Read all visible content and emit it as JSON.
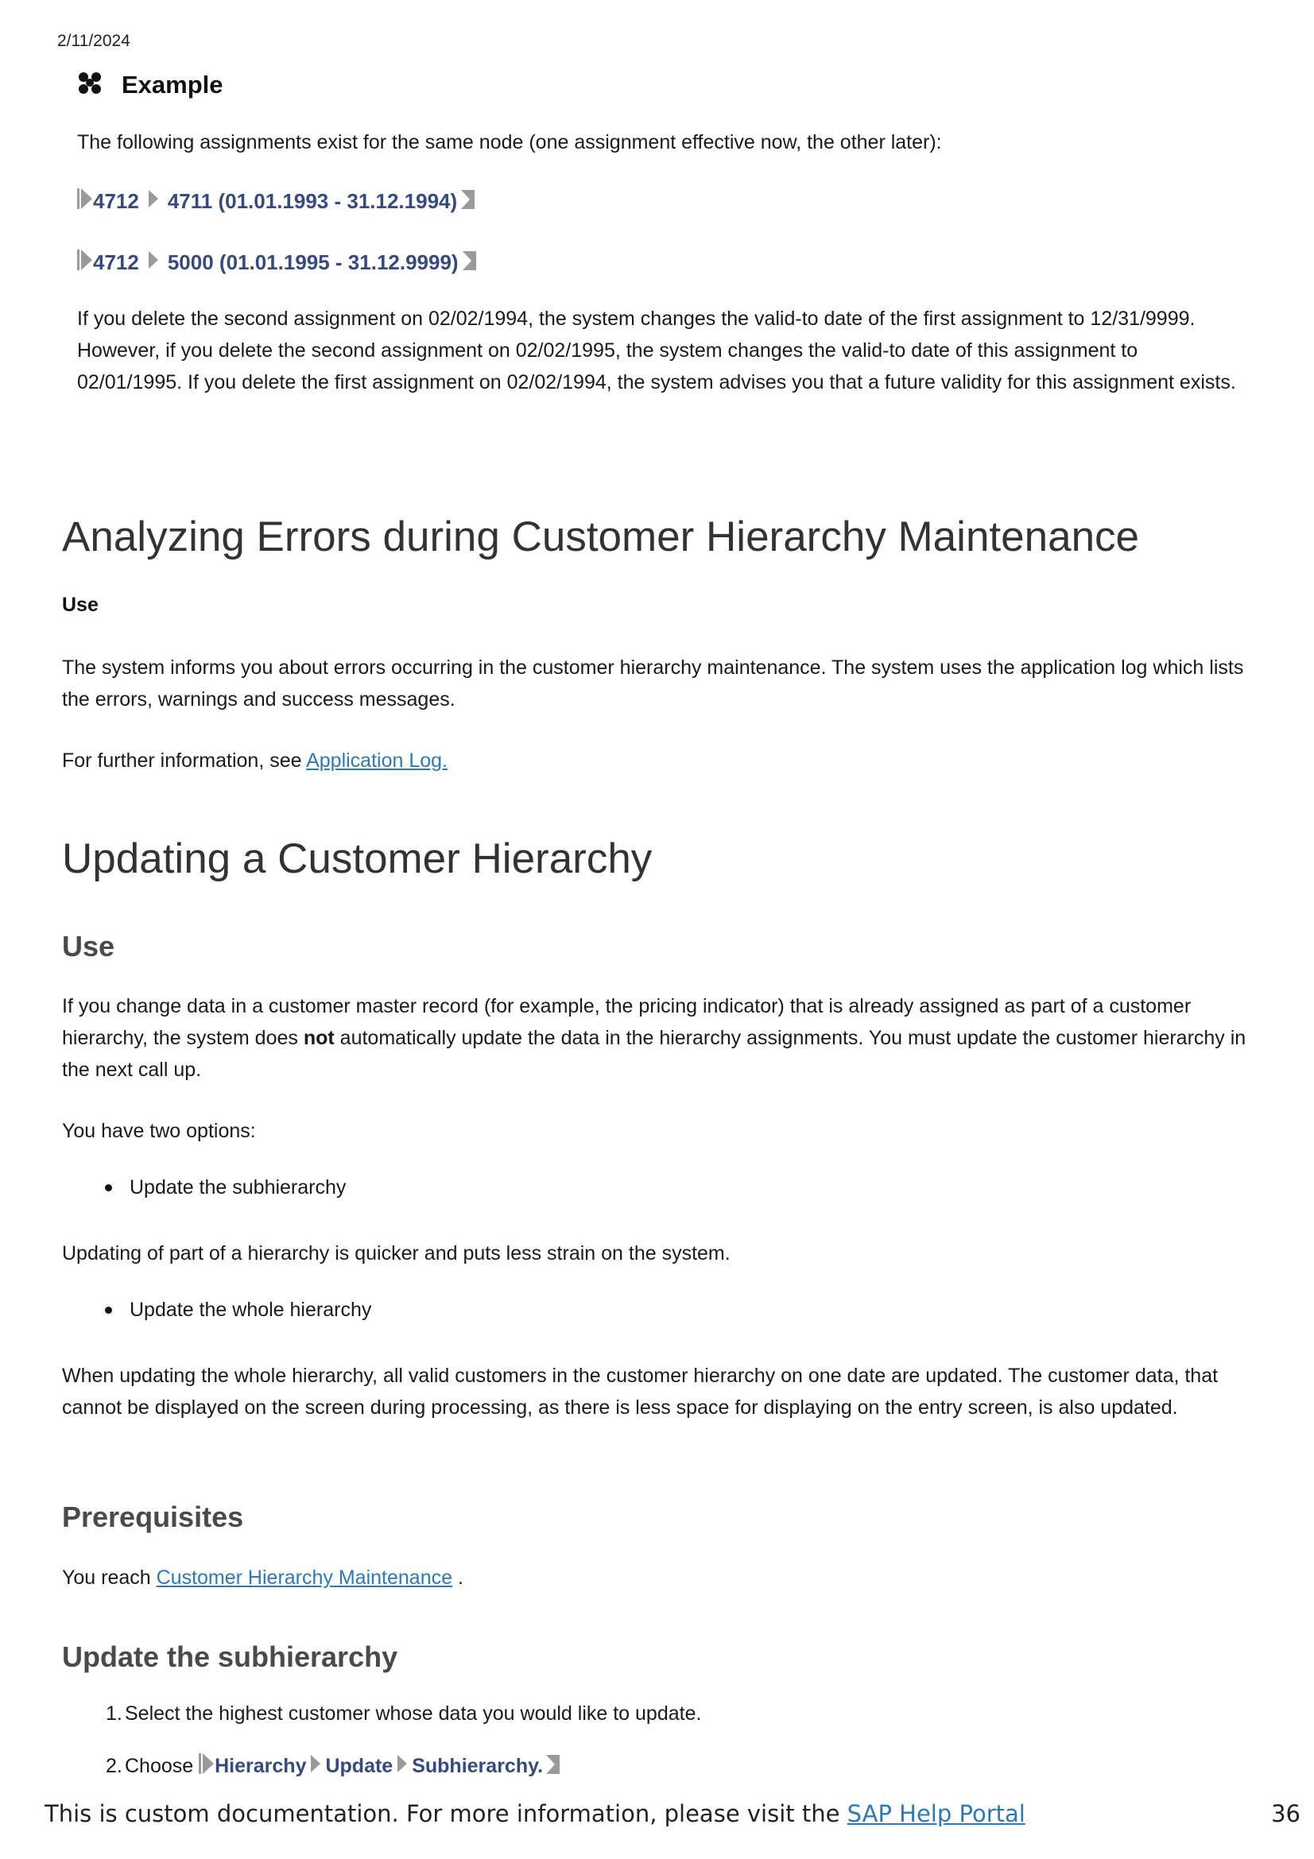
{
  "header": {
    "date": "2/11/2024"
  },
  "example": {
    "title": "Example",
    "intro": "The following assignments exist for the same node (one assignment effective now, the other later):",
    "paths": [
      {
        "node": "4712",
        "assignment": "4711 (01.01.1993 - 31.12.1994)"
      },
      {
        "node": "4712",
        "assignment": "5000 (01.01.1995 - 31.12.9999)"
      }
    ],
    "explanation": "If you delete the second assignment on 02/02/1994, the system changes the valid-to date of the first assignment to 12/31/9999. However, if you delete the second assignment on 02/02/1995, the system changes the valid-to date of this assignment to 02/01/1995. If you delete the first assignment on 02/02/1994, the system advises you that a future validity for this assignment exists."
  },
  "section_errors": {
    "title": "Analyzing Errors during Customer Hierarchy Maintenance",
    "use_label": "Use",
    "body": "The system informs you about errors occurring in the customer hierarchy maintenance. The system uses the application log which lists the errors, warnings and success messages.",
    "further_prefix": "For further information, see ",
    "further_link": "Application Log."
  },
  "section_update": {
    "title": "Updating a Customer Hierarchy",
    "use_heading": "Use",
    "use_body_before": "If you change data in a customer master record (for example, the pricing indicator) that is already assigned as part of a customer hierarchy, the system does ",
    "use_body_bold": "not",
    "use_body_after": " automatically update the data in the hierarchy assignments. You must update the customer hierarchy in the next call up.",
    "options_intro": "You have two options:",
    "option1": "Update the subhierarchy",
    "option1_desc": "Updating of part of a hierarchy is quicker and puts less strain on the system.",
    "option2": "Update the whole hierarchy",
    "option2_desc": "When updating the whole hierarchy, all valid customers in the customer hierarchy on one date are updated. The customer data, that cannot be displayed on the screen during processing, as there is less space for displaying on the entry screen, is also updated.",
    "prereq_heading": "Prerequisites",
    "prereq_prefix": "You reach ",
    "prereq_link": "Customer Hierarchy Maintenance",
    "prereq_suffix": " .",
    "sub_heading": "Update the subhierarchy",
    "step1": "Select the highest customer whose data you would like to update.",
    "step2_prefix": "Choose ",
    "step2_path": [
      "Hierarchy",
      "Update",
      "Subhierarchy."
    ]
  },
  "footer": {
    "text_prefix": "This is custom documentation. For more information, please visit the ",
    "link": "SAP Help Portal",
    "page_number": "36"
  }
}
